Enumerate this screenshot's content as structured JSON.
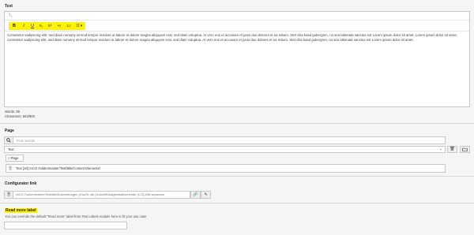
{
  "text_field": {
    "label": "Text",
    "clear_format_glyph": "Tₓ",
    "toolbar": [
      {
        "name": "bold",
        "glyph": "B"
      },
      {
        "name": "italic",
        "glyph": "I"
      },
      {
        "name": "underline",
        "glyph": "U"
      },
      {
        "name": "subscript",
        "glyph": "X₂"
      },
      {
        "name": "superscript",
        "glyph": "X²"
      },
      {
        "name": "bulleted-list",
        "glyph": "•≡"
      },
      {
        "name": "numbered-list",
        "glyph": "1≡"
      },
      {
        "name": "special-characters",
        "glyph": "Ω ▾"
      }
    ],
    "content": "Consetetur sadipscing elitr, sed diam nonumy eirmod tempor invidunt ut labore et dolore magna aliquyam erat, sed diam voluptua. At vero eos et accusam et justo duo dolores et ea rebum. Stet clita kasd gubergren, no sea takimata sanctus est Lorem ipsum dolor sit amet. Lorem ipsum dolor sit amet, consetetur sadipscing elitr, sed diam nonumy eirmod tempor invidunt ut labore et dolore magna aliquyam erat, sed diam voluptua. At vero eos et accusam et justo duo dolores et ea rebum. Stet clita kasd gubergren, no sea takimata sanctus est Lorem ipsum dolor sit amet.",
    "words": "Words: 89",
    "characters": "Characters: 563/800"
  },
  "page_field": {
    "label": "Page",
    "search_placeholder": "Find records",
    "table_select_value": "Text",
    "page_button_label": "Page",
    "record": "Text [18] /ACO Goldenmaster/Testfälle/Content Elemente/"
  },
  "configurator_field": {
    "label": "Configurator link",
    "value": "/ACO Goldenmaster/Testfälle/Anwendungen (Vsw3t, okl.)/Leichtflüssigkeitsabscheider [172] #38 separator"
  },
  "read_more_field": {
    "label": "Read more label",
    "description": "You can override the default \"Read more\" label from Text Labels module here to fit your use case"
  },
  "colors": {
    "highlight": "#fff200",
    "panel_bg": "#f5f5f5",
    "border": "#c8c8c8"
  },
  "icons": [
    "clear-format-icon",
    "search-icon",
    "chevron-down-icon",
    "trash-icon",
    "folder-icon",
    "page-icon",
    "document-icon",
    "link-icon",
    "pencil-icon"
  ]
}
